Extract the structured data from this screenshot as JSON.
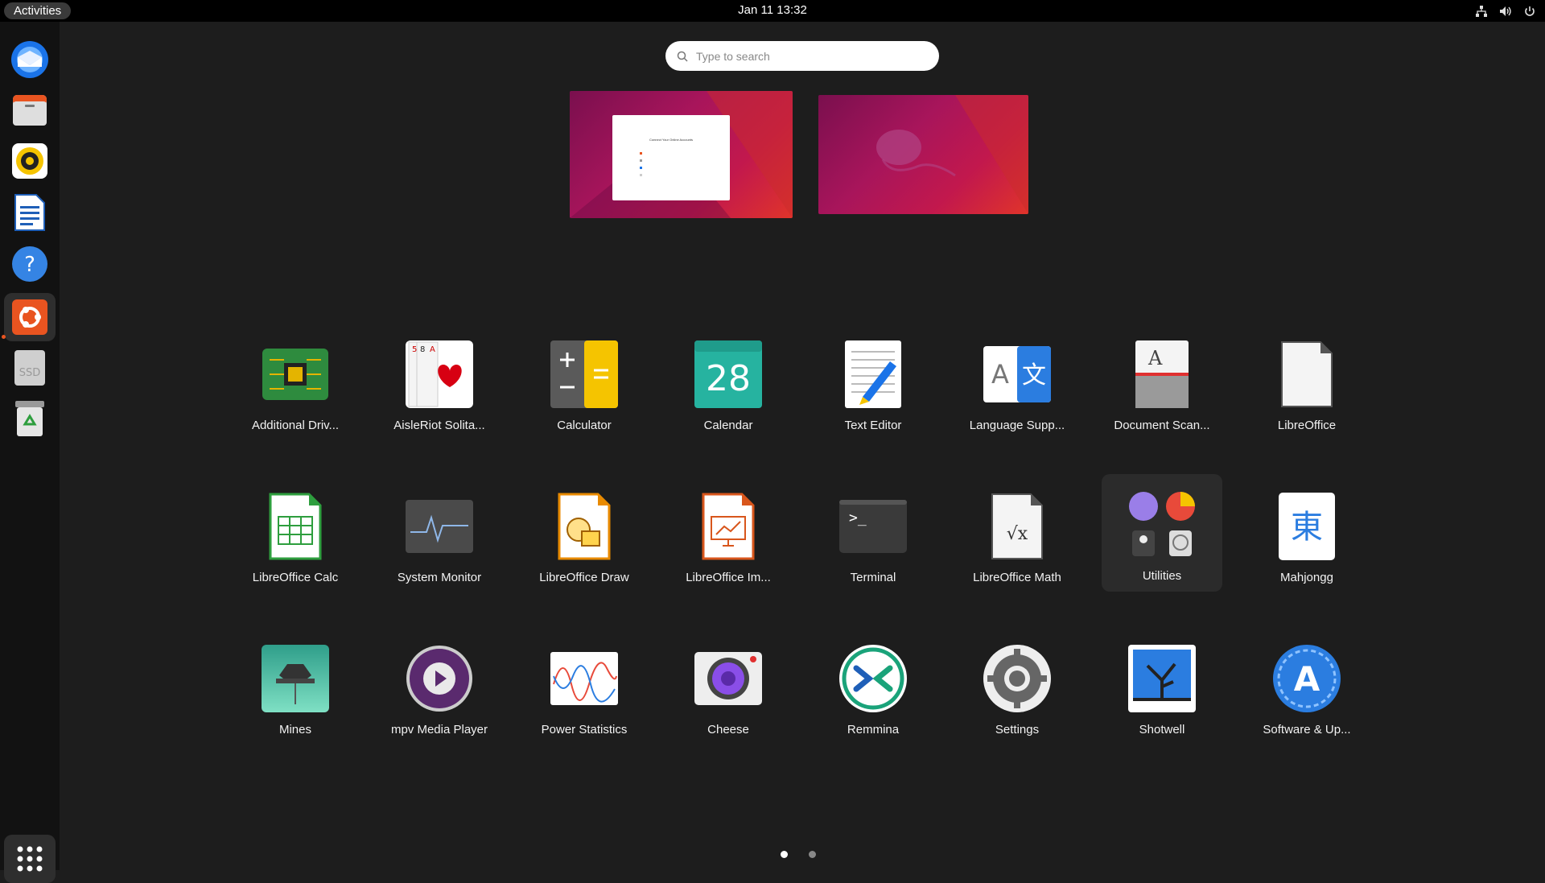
{
  "topbar": {
    "activities_label": "Activities",
    "clock": "Jan 11  13:32",
    "tray_icons": [
      "network-icon",
      "volume-icon",
      "power-icon"
    ]
  },
  "dock": {
    "items": [
      {
        "name": "thunderbird",
        "icon": "thunderbird-icon"
      },
      {
        "name": "files",
        "icon": "files-icon"
      },
      {
        "name": "rhythmbox",
        "icon": "rhythmbox-icon"
      },
      {
        "name": "libreoffice-writer",
        "icon": "writer-icon"
      },
      {
        "name": "help",
        "icon": "help-icon"
      },
      {
        "name": "ubuntu-software-running",
        "icon": "ubuntu-icon"
      },
      {
        "name": "ssd-drive",
        "icon": "drive-icon",
        "label": "SSD"
      },
      {
        "name": "trash",
        "icon": "trash-icon"
      }
    ],
    "show_apps_icon": "show-apps-grid-icon"
  },
  "search": {
    "placeholder": "Type to search"
  },
  "workspaces": [
    {
      "name": "workspace-1",
      "window_title": "Connect Your Online Accounts"
    },
    {
      "name": "workspace-2"
    }
  ],
  "apps": [
    {
      "label": "Additional Driv...",
      "icon": "chip-icon"
    },
    {
      "label": "AisleRiot Solita...",
      "icon": "cards-icon"
    },
    {
      "label": "Calculator",
      "icon": "calculator-icon"
    },
    {
      "label": "Calendar",
      "icon": "calendar-icon",
      "day": "28"
    },
    {
      "label": "Text Editor",
      "icon": "text-editor-icon"
    },
    {
      "label": "Language Supp...",
      "icon": "language-icon",
      "glyphs": [
        "A",
        "文"
      ]
    },
    {
      "label": "Document Scan...",
      "icon": "scanner-icon",
      "glyph": "A"
    },
    {
      "label": "LibreOffice",
      "icon": "libreoffice-icon"
    },
    {
      "label": "LibreOffice Calc",
      "icon": "calc-icon"
    },
    {
      "label": "System Monitor",
      "icon": "system-monitor-icon"
    },
    {
      "label": "LibreOffice Draw",
      "icon": "draw-icon"
    },
    {
      "label": "LibreOffice Im...",
      "icon": "impress-icon"
    },
    {
      "label": "Terminal",
      "icon": "terminal-icon",
      "glyph": ">_"
    },
    {
      "label": "LibreOffice Math",
      "icon": "math-icon",
      "glyph": "√x"
    },
    {
      "label": "Utilities",
      "icon": "utilities-folder-icon"
    },
    {
      "label": "Mahjongg",
      "icon": "mahjongg-icon",
      "glyph": "東"
    },
    {
      "label": "Mines",
      "icon": "mines-icon"
    },
    {
      "label": "mpv Media Player",
      "icon": "mpv-icon"
    },
    {
      "label": "Power Statistics",
      "icon": "power-statistics-icon"
    },
    {
      "label": "Cheese",
      "icon": "cheese-icon"
    },
    {
      "label": "Remmina",
      "icon": "remmina-icon"
    },
    {
      "label": "Settings",
      "icon": "settings-gear-icon"
    },
    {
      "label": "Shotwell",
      "icon": "shotwell-icon"
    },
    {
      "label": "Software & Up...",
      "icon": "software-updates-icon",
      "glyph": "A"
    }
  ],
  "pagination": {
    "pages": 2,
    "current": 1
  },
  "colors": {
    "accent": "#e95420",
    "background": "#1d1d1d",
    "dock": "#121212"
  }
}
